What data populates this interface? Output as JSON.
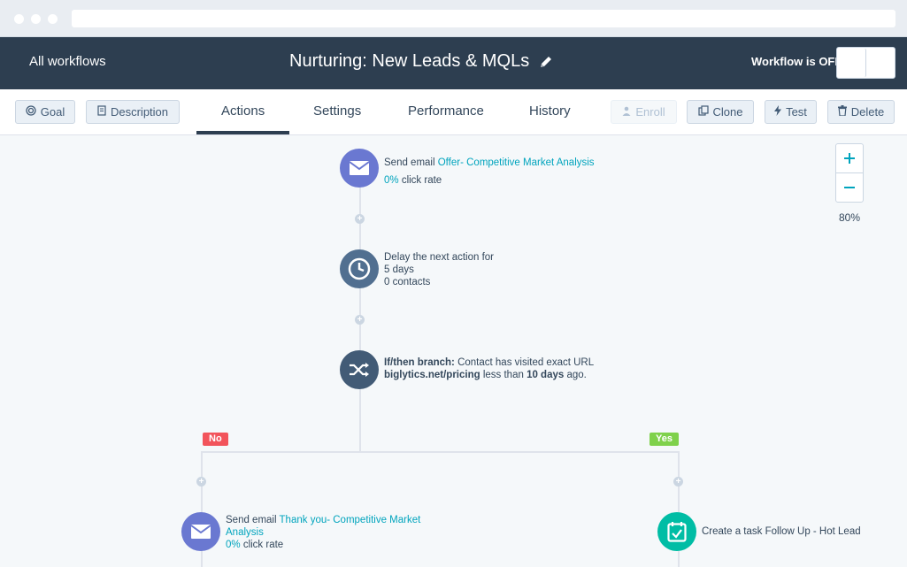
{
  "header": {
    "back_link": "All workflows",
    "title": "Nurturing: New Leads & MQLs",
    "status_label": "Workflow is OFF"
  },
  "toolbar": {
    "goal": "Goal",
    "description": "Description",
    "enroll": "Enroll",
    "clone": "Clone",
    "test": "Test",
    "delete": "Delete"
  },
  "tabs": [
    "Actions",
    "Settings",
    "Performance",
    "History"
  ],
  "zoom": {
    "level": "80%"
  },
  "workflow": {
    "step1": {
      "prefix": "Send email ",
      "email_name": "Offer- Competitive Market Analysis",
      "rate": "0%",
      "rate_suffix": " click rate"
    },
    "step2": {
      "line1": "Delay the next action for",
      "line2": "5 days",
      "line3": "0 contacts"
    },
    "step3": {
      "prefix": "If/then branch:",
      "mid": " Contact has visited exact URL",
      "url": "biglytics.net/pricing",
      "mid2": " less than ",
      "days": "10 days",
      "end": " ago."
    },
    "branch_no": "No",
    "branch_yes": "Yes",
    "step_no": {
      "prefix": "Send email ",
      "email_name_1": "Thank you- Competitive Market",
      "email_name_2": "Analysis",
      "rate": "0%",
      "rate_suffix": " click rate"
    },
    "step_yes": {
      "text": "Create a task Follow Up - Hot Lead"
    }
  },
  "colors": {
    "header_bg": "#2d3e50",
    "email_icon": "#6a78d1",
    "delay_icon": "#516f90",
    "branch_icon": "#425b76",
    "task_icon": "#00bda5",
    "no_pill": "#f2545b",
    "yes_pill": "#7fd14b",
    "link": "#00a4bd"
  }
}
